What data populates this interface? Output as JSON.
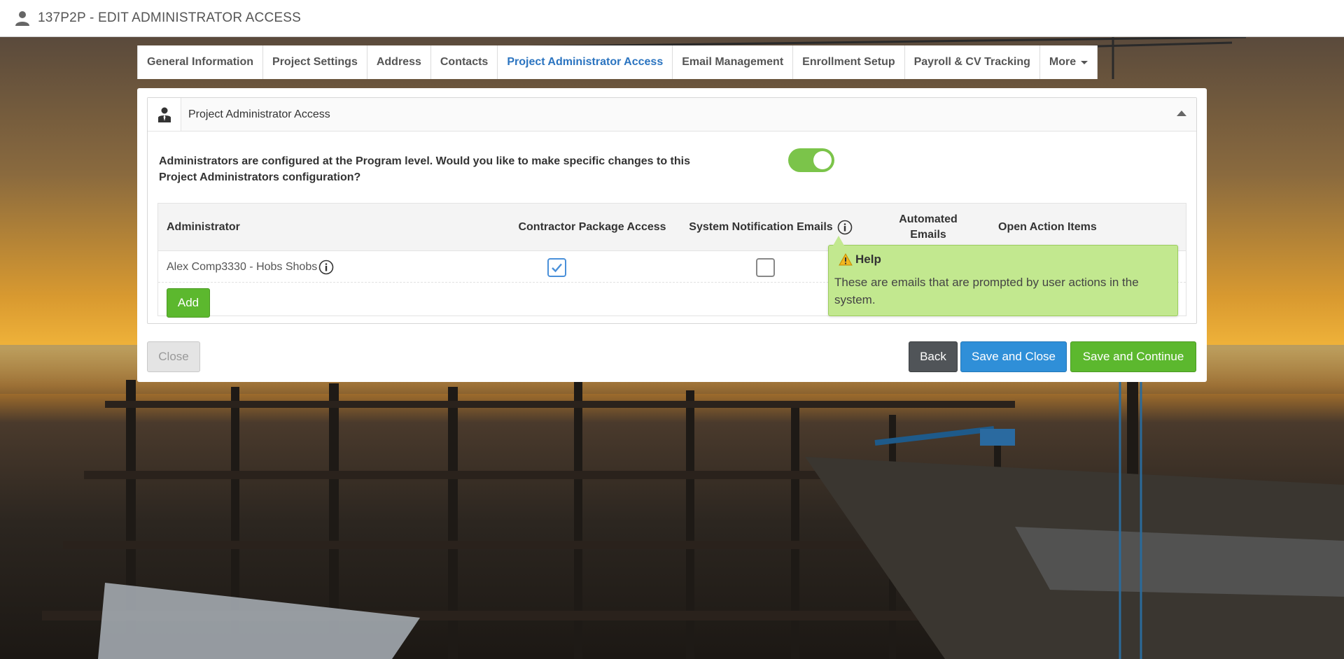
{
  "header": {
    "title": "137P2P - EDIT ADMINISTRATOR ACCESS"
  },
  "tabs": [
    {
      "label": "General Information",
      "active": false
    },
    {
      "label": "Project Settings",
      "active": false
    },
    {
      "label": "Address",
      "active": false
    },
    {
      "label": "Contacts",
      "active": false
    },
    {
      "label": "Project Administrator Access",
      "active": true
    },
    {
      "label": "Email Management",
      "active": false
    },
    {
      "label": "Enrollment Setup",
      "active": false
    },
    {
      "label": "Payroll & CV Tracking",
      "active": false
    },
    {
      "label": "More",
      "active": false
    }
  ],
  "section": {
    "title": "Project Administrator Access",
    "icon": "admin-user-icon",
    "question": "Administrators are configured at the Program level. Would you like to make specific changes to this Project Administrators configuration?",
    "override_enabled": true
  },
  "table": {
    "columns": [
      "Administrator",
      "Contractor Package Access",
      "System Notification Emails",
      "Automated Emails",
      "Open Action Items"
    ],
    "rows": [
      {
        "administrator": "Alex Comp3330 - Hobs Shobs",
        "contractor_package_access": true,
        "system_notification_emails": false
      }
    ],
    "add_label": "Add"
  },
  "help_tooltip": {
    "title": "Help",
    "body": "These are emails that are prompted by user actions in the system."
  },
  "footer": {
    "close_label": "Close",
    "back_label": "Back",
    "save_close_label": "Save and Close",
    "save_continue_label": "Save and Continue"
  },
  "colors": {
    "accent_blue": "#2b74c0",
    "primary_green": "#5cb82e",
    "save_blue": "#2f8fd8",
    "back_dark": "#505458",
    "help_green": "#c2e88f"
  }
}
